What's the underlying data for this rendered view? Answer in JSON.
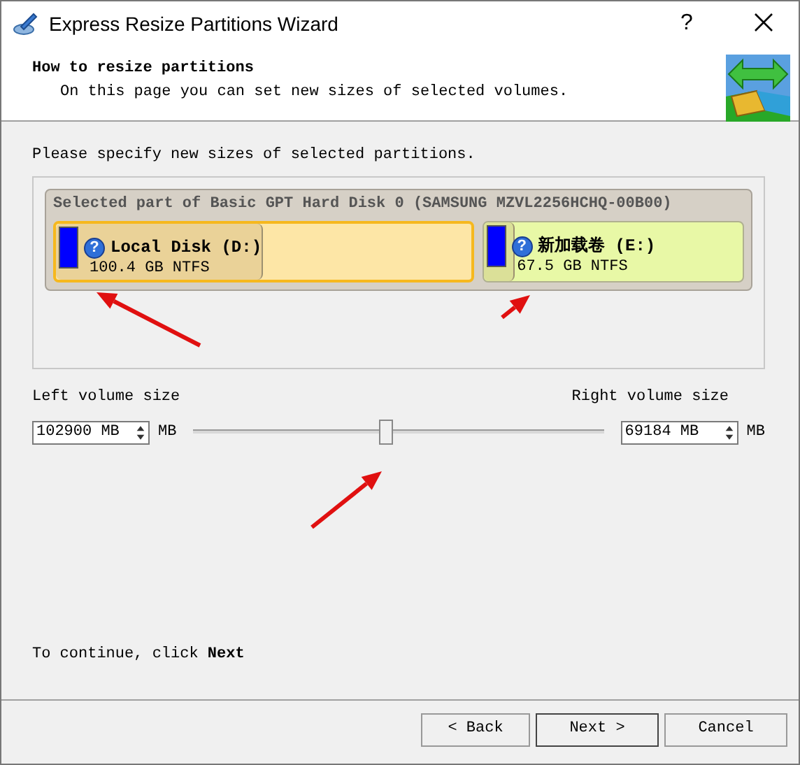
{
  "window": {
    "title": "Express Resize Partitions Wizard",
    "help": "?"
  },
  "header": {
    "title": "How to resize partitions",
    "subtitle": "On this page you can set new sizes of selected volumes."
  },
  "instruction": "Please specify new sizes of selected partitions.",
  "disk": {
    "caption": "Selected part of Basic GPT Hard Disk 0 (SAMSUNG MZVL2256HCHQ-00B00)",
    "partitions": [
      {
        "name": "Local Disk (D:)",
        "size": "100.4 GB NTFS",
        "info_mark": "?",
        "selected": true,
        "level": 0.5,
        "color": "#fde6a6"
      },
      {
        "name": "新加载卷 (E:)",
        "size": "67.5 GB NTFS",
        "info_mark": "?",
        "selected": false,
        "level": 0.12,
        "color": "#e8f8a6"
      }
    ]
  },
  "resize": {
    "left_label": "Left volume size",
    "left_value": "102900 MB",
    "left_unit": "MB",
    "right_label": "Right volume size",
    "right_value": "69184 MB",
    "right_unit": "MB",
    "level": 0.47
  },
  "footer_note": "To continue, click **Next**",
  "buttons": [
    {
      "label": "< Back"
    },
    {
      "label": "Next >"
    },
    {
      "label": "Cancel"
    }
  ]
}
